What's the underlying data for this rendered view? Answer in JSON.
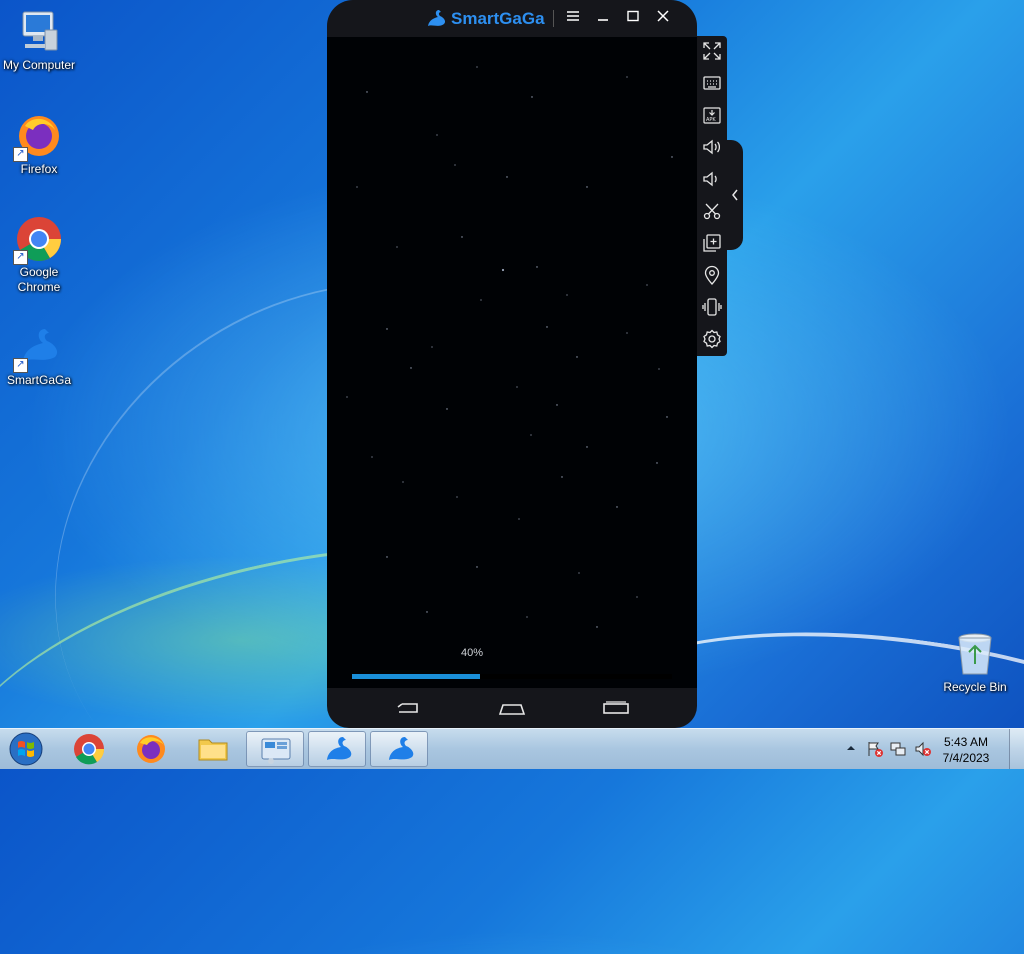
{
  "desktop": {
    "icons": [
      {
        "label": "My Computer"
      },
      {
        "label": "Firefox"
      },
      {
        "label": "Google\nChrome"
      },
      {
        "label": "SmartGaGa"
      },
      {
        "label": "Recycle Bin"
      }
    ]
  },
  "emulator": {
    "title": "SmartGaGa",
    "title_controls": [
      "menu-icon",
      "minimize-icon",
      "maximize-icon",
      "close-icon"
    ],
    "loading": {
      "percent_text": "40%",
      "progress": 0.4
    },
    "nav_buttons": [
      "back-icon",
      "home-icon",
      "recent-apps-icon"
    ],
    "sidebar_tools": [
      "fullscreen-icon",
      "keyboard-icon",
      "install-apk-icon",
      "volume-up-icon",
      "volume-down-icon",
      "screenshot-scissors-icon",
      "multi-instance-icon",
      "location-icon",
      "shake-icon",
      "settings-gear-icon"
    ],
    "collapse_arrow": "chevron-left-icon"
  },
  "taskbar": {
    "pinned": [
      "windows-start-icon",
      "chrome-icon",
      "firefox-icon",
      "explorer-folder-icon",
      "control-panel-icon",
      "smartgaga-icon",
      "smartgaga-icon"
    ],
    "clock_time": "5:43 AM",
    "clock_date": "7/4/2023"
  },
  "colors": {
    "accent": "#1a8fd9",
    "emulator_bg": "#15161b",
    "taskbar": "#b7d0e8"
  }
}
